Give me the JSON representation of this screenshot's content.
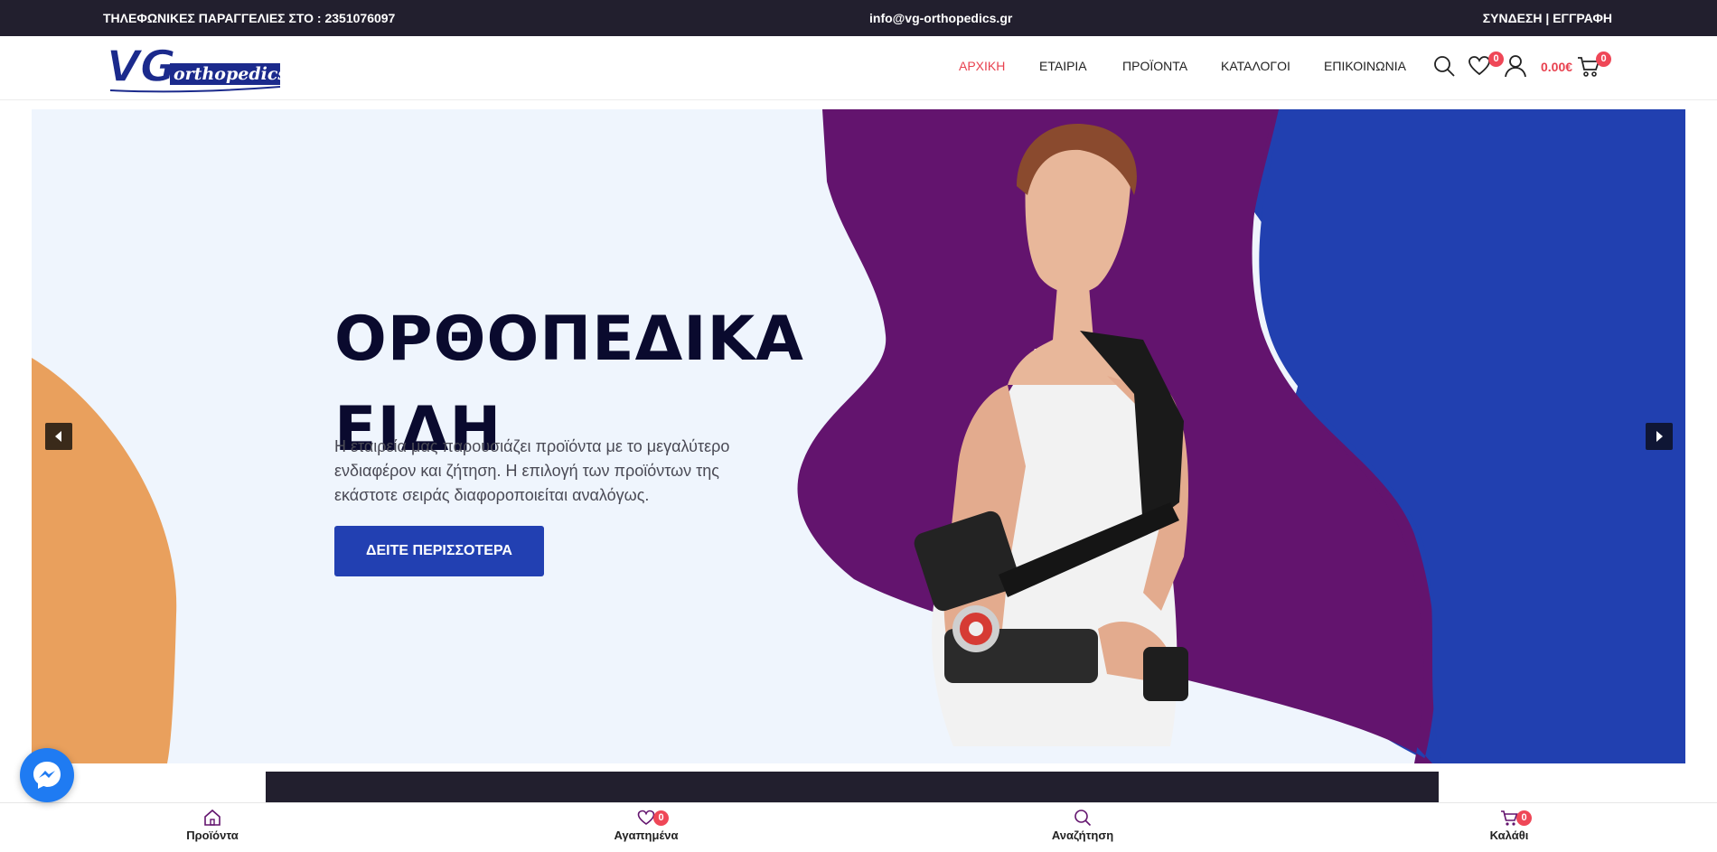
{
  "topbar": {
    "phone": "ΤΗΛΕΦΩΝΙΚΕΣ ΠΑΡΑΓΓΕΛΙΕΣ ΣΤΟ : 2351076097",
    "email": "info@vg-orthopedics.gr",
    "login": "ΣΥΝΔΕΣΗ",
    "separator": " | ",
    "register": "ΕΓΓΡΑΦΗ"
  },
  "header": {
    "logo_text": "VG",
    "logo_subtext": "orthopedics",
    "nav": [
      "ΑΡΧΙΚΗ",
      "ΕΤΑΙΡΙΑ",
      "ΠΡΟΪΟΝΤΑ",
      "ΚΑΤΑΛΟΓΟΙ",
      "ΕΠΙΚΟΙΝΩΝΙΑ"
    ],
    "active_nav": "ΑΡΧΙΚΗ",
    "wishlist_count": "0",
    "cart_total": "0.00€",
    "cart_count": "0"
  },
  "hero": {
    "title_line1": "ΟΡΘΟΠΕΔΙΚΑ",
    "title_line2": "ΕΙΔΗ",
    "text": "Η εταιρεία μας παρουσιάζει προϊόντα με το μεγαλύτερο ενδιαφέρον και ζήτηση. Η επιλογή των προϊόντων της εκάστοτε σειράς διαφοροποιείται αναλόγως.",
    "button": "ΔΕΙΤΕ ΠΕΡΙΣΣΟΤΕΡΑ"
  },
  "bottombar": {
    "products": "Προϊόντα",
    "wishlist": "Αγαπημένα",
    "wishlist_count": "0",
    "search": "Αναζήτηση",
    "cart": "Καλάθι",
    "cart_count": "0"
  },
  "colors": {
    "topbar_bg": "#221f2e",
    "accent_red": "#e8414f",
    "badge": "#ef4757",
    "button_blue": "#2240b2",
    "hero_bg": "#eff5fd",
    "purple": "#63146e",
    "blue": "#2140b0",
    "orange": "#e9a05d",
    "messenger": "#1f7bf2"
  }
}
